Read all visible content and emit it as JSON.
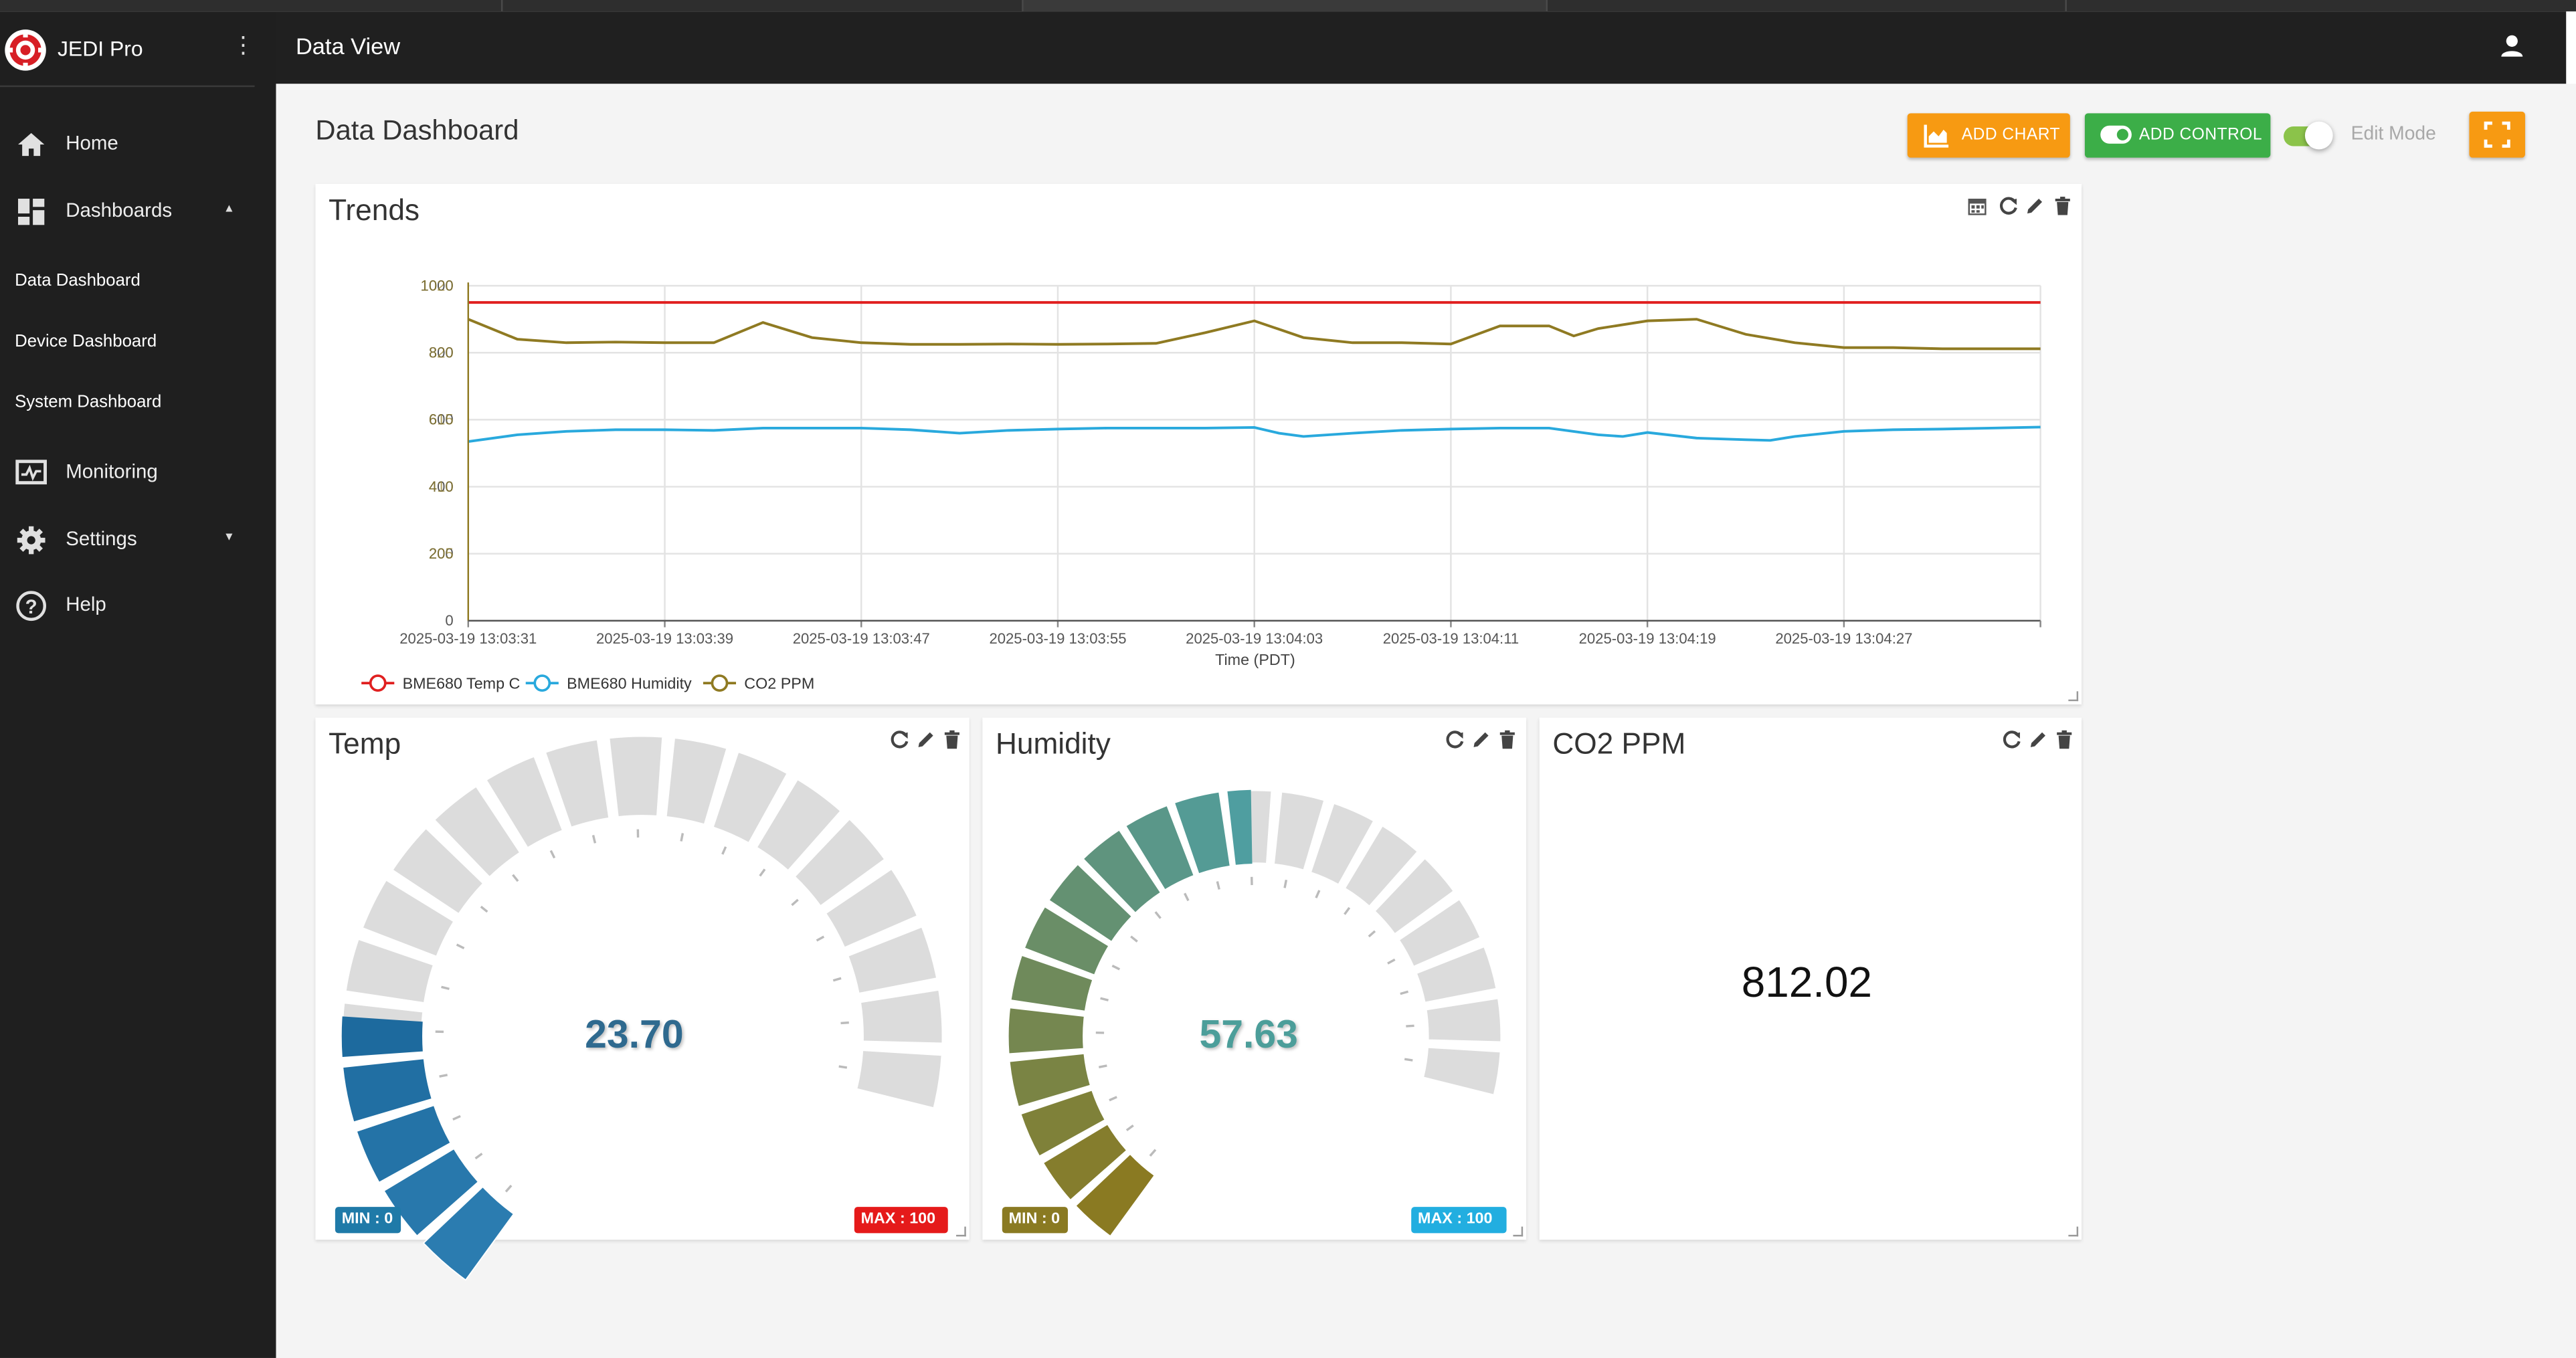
{
  "app": {
    "name": "JEDI Pro"
  },
  "topbar": {
    "title": "Data View"
  },
  "sidebar": {
    "items": [
      {
        "label": "Home",
        "icon": "home-icon"
      },
      {
        "label": "Dashboards",
        "icon": "dashboard-icon"
      },
      {
        "label": "Monitoring",
        "icon": "monitoring-icon"
      },
      {
        "label": "Settings",
        "icon": "gear-icon"
      },
      {
        "label": "Help",
        "icon": "help-icon"
      }
    ],
    "dashboards": [
      "Data Dashboard",
      "Device Dashboard",
      "System Dashboard"
    ]
  },
  "page": {
    "title": "Data Dashboard"
  },
  "toolbar": {
    "add_chart": "ADD CHART",
    "add_control": "ADD CONTROL",
    "edit_mode_label": "Edit Mode",
    "edit_mode_on": true
  },
  "colors": {
    "orange": "#f79a12",
    "green": "#3cae48",
    "temp": "#e02020",
    "humidity": "#29a9dd",
    "co2": "#8f7a22",
    "gauge_empty": "#dcdcdc"
  },
  "trends": {
    "title": "Trends",
    "xlabel": "Time (PDT)",
    "legend": [
      "BME680 Temp C",
      "BME680 Humidity",
      "CO2 PPM"
    ]
  },
  "chart_data": {
    "type": "line",
    "title": "Trends",
    "xlabel": "Time (PDT)",
    "ylabel": "",
    "ylim": [
      0,
      1000
    ],
    "grid": true,
    "legend_position": "bottom-left",
    "y_ticks": [
      {
        "label": "1000",
        "overlay": "1020",
        "value": 1000
      },
      {
        "label": "800",
        "overlay": "820",
        "value": 800
      },
      {
        "label": "600",
        "overlay": "615",
        "value": 600
      },
      {
        "label": "400",
        "overlay": "410",
        "value": 400
      },
      {
        "label": "200",
        "overlay": "205",
        "value": 200
      },
      {
        "label": "0",
        "overlay": "",
        "value": 0
      }
    ],
    "x_ticks": [
      "2025-03-19 13:03:31",
      "2025-03-19 13:03:39",
      "2025-03-19 13:03:47",
      "2025-03-19 13:03:55",
      "2025-03-19 13:04:03",
      "2025-03-19 13:04:11",
      "2025-03-19 13:04:19",
      "2025-03-19 13:04:27"
    ],
    "x_seconds_range": [
      0,
      64
    ],
    "series": [
      {
        "name": "BME680 Temp C",
        "color": "#e02020",
        "values": [
          950,
          950,
          950,
          950,
          950,
          950,
          950,
          950,
          950,
          950,
          950,
          950,
          950,
          950,
          950,
          950,
          950
        ]
      },
      {
        "name": "BME680 Humidity",
        "color": "#29a9dd",
        "x": [
          0,
          2,
          4,
          6,
          8,
          10,
          12,
          14,
          16,
          18,
          20,
          22,
          24,
          26,
          28,
          30,
          32,
          33,
          34,
          36,
          38,
          40,
          42,
          44,
          46,
          47,
          48,
          50,
          52,
          53,
          54,
          56,
          58,
          60,
          62,
          64
        ],
        "values": [
          535,
          555,
          565,
          570,
          570,
          568,
          575,
          575,
          575,
          570,
          560,
          568,
          572,
          575,
          575,
          575,
          577,
          560,
          550,
          560,
          568,
          572,
          575,
          575,
          555,
          550,
          562,
          545,
          540,
          538,
          550,
          565,
          570,
          572,
          575,
          578
        ]
      },
      {
        "name": "CO2 PPM",
        "color": "#8f7a22",
        "x": [
          0,
          2,
          4,
          6,
          8,
          10,
          12,
          14,
          16,
          18,
          20,
          22,
          24,
          26,
          28,
          30,
          32,
          33,
          34,
          36,
          38,
          40,
          42,
          44,
          45,
          46,
          48,
          50,
          52,
          54,
          56,
          58,
          60,
          62,
          64
        ],
        "values": [
          900,
          840,
          830,
          832,
          830,
          830,
          890,
          845,
          830,
          825,
          825,
          826,
          825,
          826,
          828,
          860,
          895,
          870,
          845,
          830,
          830,
          826,
          880,
          880,
          850,
          872,
          895,
          900,
          855,
          830,
          815,
          815,
          812,
          812,
          812
        ]
      }
    ]
  },
  "gauges": {
    "temp": {
      "title": "Temp",
      "value": "23.70",
      "min_label": "MIN : 0",
      "max_label": "MAX : 100",
      "level": 23.7
    },
    "humidity": {
      "title": "Humidity",
      "value": "57.63",
      "min_label": "MIN : 0",
      "max_label": "MAX : 100",
      "level": 57.63
    }
  },
  "co2": {
    "title": "CO2 PPM",
    "value": "812.02"
  }
}
